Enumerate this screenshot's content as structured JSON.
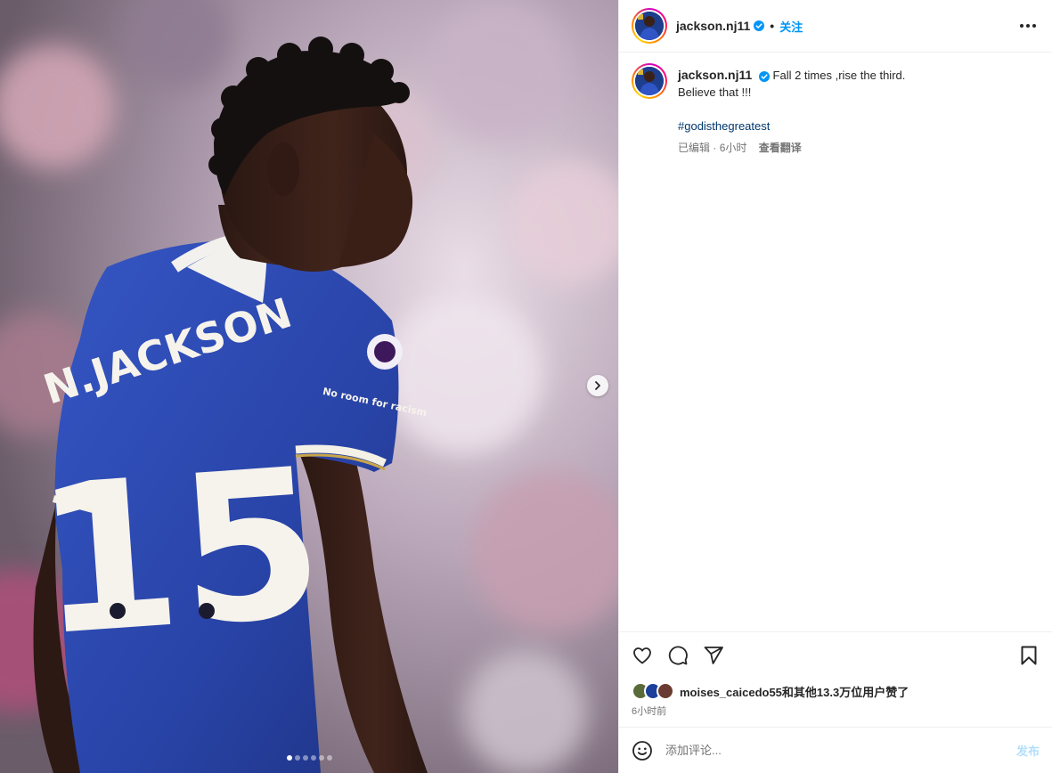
{
  "colors": {
    "accent": "#0095f6",
    "hashtag": "#00376b",
    "post_disabled": "#b2dffc",
    "jersey_blue": "#2f4fbf"
  },
  "media": {
    "slide_count": 6,
    "active_slide": 1,
    "jersey_name": "N.JACKSON",
    "jersey_number": "15",
    "sleeve_sponsor": "No room for racism",
    "next_icon": "chevron-right-icon"
  },
  "header": {
    "username": "jackson.nj11",
    "verified_icon": "verified-badge-icon",
    "separator": "•",
    "follow_label": "关注",
    "more_icon": "more-horizontal-icon"
  },
  "caption": {
    "username": "jackson.nj11",
    "line1": "Fall 2 times ,rise the third.",
    "line2": "Believe that !!!",
    "hashtag": "#godisthegreatest",
    "edited": "已编辑",
    "dot": " · ",
    "age": "6小时",
    "translate": "查看翻译"
  },
  "actions": {
    "like_icon": "heart-icon",
    "comment_icon": "comment-icon",
    "share_icon": "send-icon",
    "save_icon": "bookmark-icon"
  },
  "likes": {
    "text": "moises_caicedo55和其他13.3万位用户赞了"
  },
  "timestamp": "6小时前",
  "comment_box": {
    "emoji_icon": "emoji-icon",
    "placeholder": "添加评论...",
    "post_label": "发布"
  }
}
